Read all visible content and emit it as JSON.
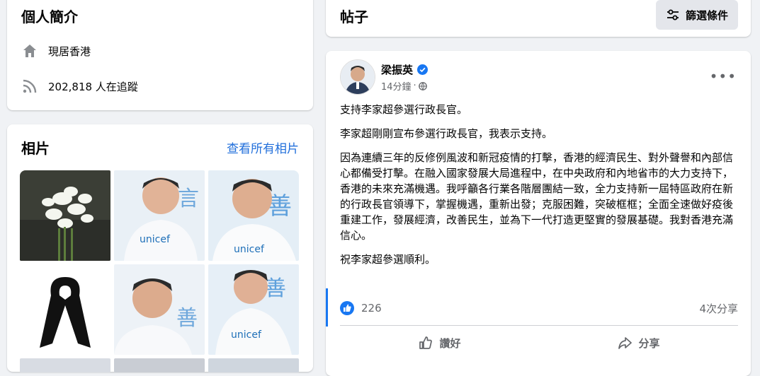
{
  "intro": {
    "title": "個人簡介",
    "location": "現居香港",
    "followers": "202,818 人在追蹤"
  },
  "photos": {
    "title": "相片",
    "see_all": "查看所有相片"
  },
  "posts_header": {
    "title": "帖子",
    "filter_label": "篩選條件"
  },
  "post": {
    "author": "梁振英",
    "time": "14分鐘",
    "dot": "·",
    "paragraphs": [
      "支持李家超參選行政長官。",
      "李家超剛剛宣布參選行政長官，我表示支持。",
      "因為連續三年的反修例風波和新冠疫情的打擊，香港的經濟民生、對外聲譽和內部信心都備受打擊。在融入國家發展大局進程中，在中央政府和內地省市的大力支持下，香港的未來充滿機遇。我呼籲各行業各階層團結一致，全力支持新一屆特區政府在新的行政長官領導下，掌握機遇，重新出發；克服困難，突破框框；全面全速做好疫後重建工作，發展經濟，改善民生，並為下一代打造更堅實的發展基礎。我對香港充滿信心。",
      "祝李家超參選順利。"
    ],
    "likes": "226",
    "shares": "4次分享",
    "like_label": "讚好",
    "share_label": "分享"
  },
  "colors": {
    "accent": "#1877f2",
    "link": "#216fdb",
    "secondary_text": "#65676b",
    "background": "#f0f2f5"
  }
}
